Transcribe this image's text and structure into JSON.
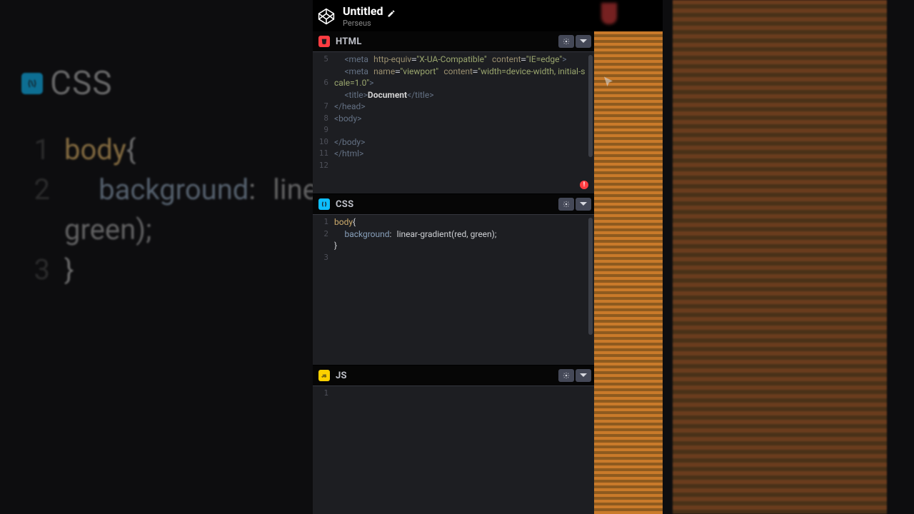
{
  "header": {
    "title": "Untitled",
    "author": "Perseus"
  },
  "panels": {
    "html": {
      "label": "HTML",
      "gutter": [
        "5",
        "",
        "6",
        "",
        "7",
        "8",
        "9",
        "10",
        "11",
        "12"
      ],
      "code_html": "  <span class='t-tag'>&lt;meta</span> <span class='t-attr'>http-equiv</span>=<span class='t-str'>\"X-UA-Compatible\"</span> <span class='t-attr'>content</span>=<span class='t-str'>\"IE=edge\"</span><span class='t-tag'>&gt;</span>\n  <span class='t-tag'>&lt;meta</span> <span class='t-attr'>name</span>=<span class='t-str'>\"viewport\"</span> <span class='t-attr'>content</span>=<span class='t-str'>\"width=device-width, initial-scale=1.0\"</span><span class='t-tag'>&gt;</span>\n  <span class='t-tag'>&lt;title&gt;</span><span class='t-text'>Document</span><span class='t-tag'>&lt;/title&gt;</span>\n<span class='t-tag'>&lt;/head&gt;</span>\n<span class='t-tag'>&lt;body&gt;</span>\n\n<span class='t-tag'>&lt;/body&gt;</span>\n<span class='t-tag'>&lt;/html&gt;</span>",
      "has_error": true
    },
    "css": {
      "label": "CSS",
      "gutter": [
        "1",
        "2",
        "",
        "3"
      ],
      "code_html": "<span class='t-sel'>body</span><span class='t-p'>{</span>\n  <span class='t-prop'>background</span><span class='t-p'>:</span> <span class='t-val'>linear-gradient(red, green)</span><span class='t-p'>;</span>\n<span class='t-p'>}</span>"
    },
    "js": {
      "label": "JS",
      "gutter": [
        "1"
      ],
      "code_html": ""
    }
  },
  "background_zoom": {
    "label": "CSS",
    "lines": [
      {
        "n": "1",
        "html": "<span class='bg-sel'>body</span><span class='bg-punc'>{</span>"
      },
      {
        "n": "2",
        "html": "  <span class='bg-prop'>background</span><span class='bg-punc'>:</span> <span class='bg-val'>line</span>"
      },
      {
        "n": "",
        "html": "<span class='bg-val'>green);</span>"
      },
      {
        "n": "3",
        "html": "<span class='bg-punc'>}</span>"
      }
    ]
  }
}
